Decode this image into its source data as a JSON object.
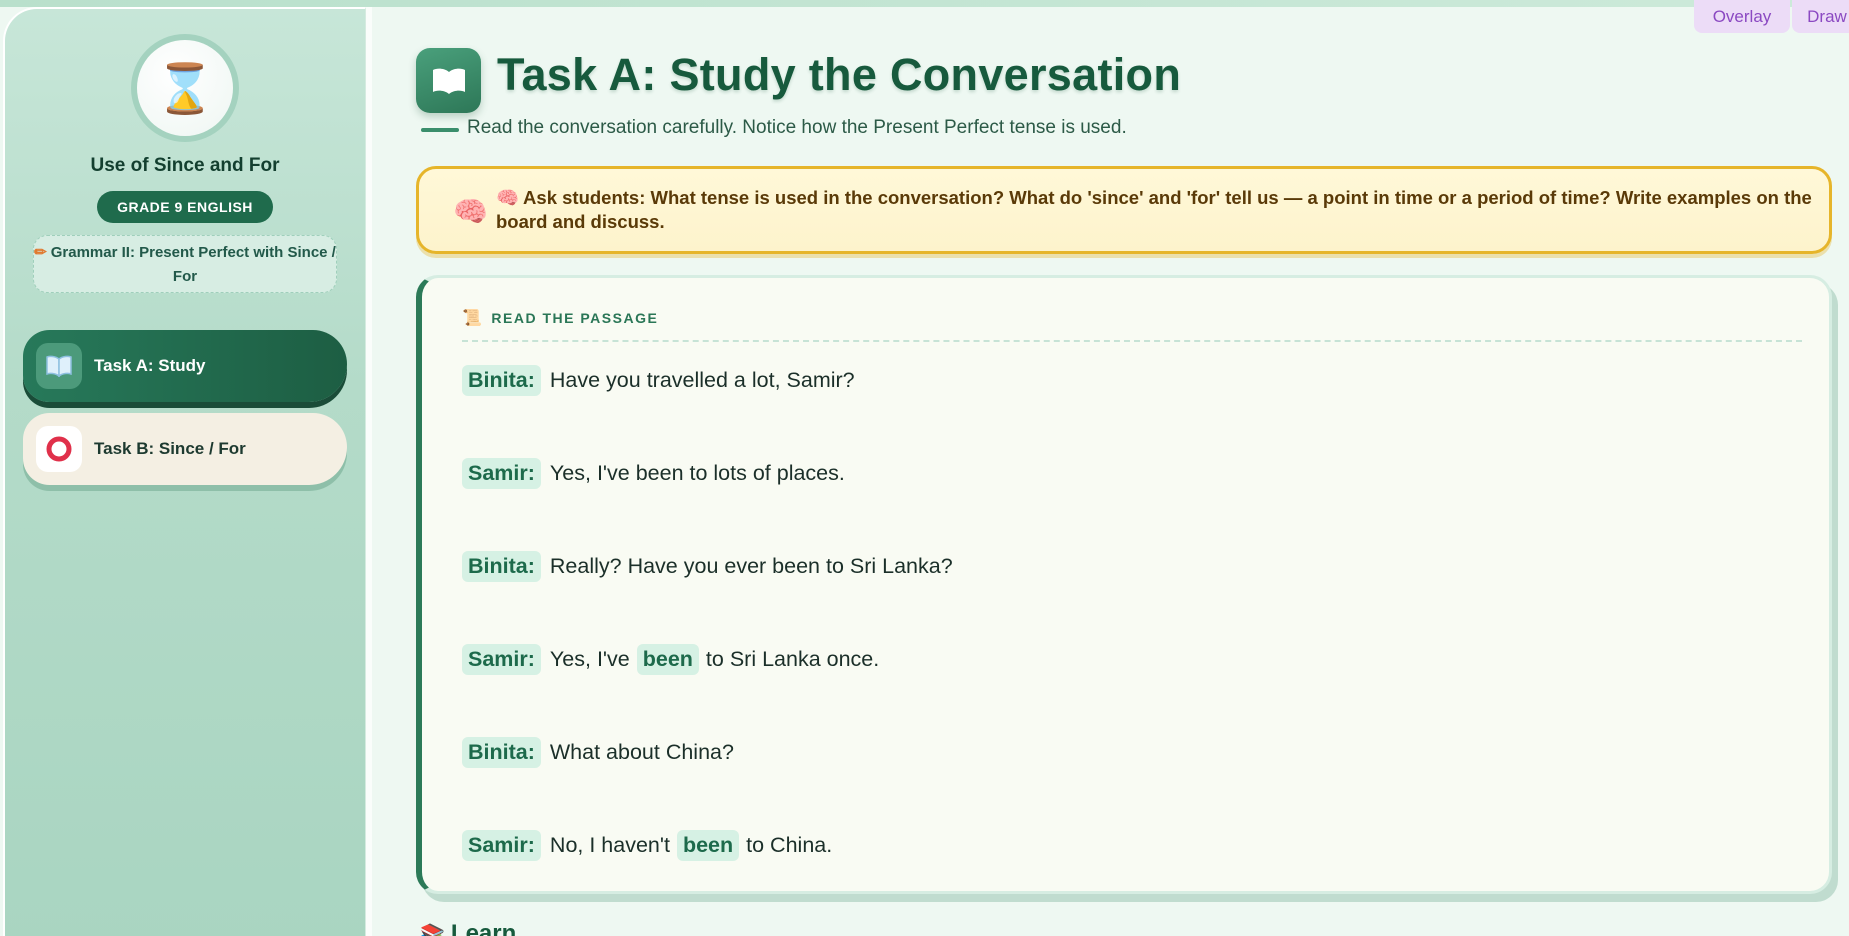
{
  "tools": {
    "overlay": "Overlay",
    "draw": "Draw"
  },
  "sidebar": {
    "title": "Use of Since and For",
    "grade": "GRADE 9 ENGLISH",
    "topic": "Grammar II: Present Perfect with Since / For",
    "avatar_icon": "hourglass-icon",
    "nav": [
      {
        "label": "Task A: Study",
        "icon": "book-icon",
        "active": true
      },
      {
        "label": "Task B: Since / For",
        "icon": "ring-icon",
        "active": false
      }
    ]
  },
  "main": {
    "title": "Task A: Study the Conversation",
    "subtitle": "Read the conversation carefully. Notice how the Present Perfect tense is used.",
    "tip": "Ask students: What tense is used in the conversation? What do 'since' and 'for' tell us — a point in time or a period of time? Write examples on the board and discuss.",
    "passage_label": "READ THE PASSAGE",
    "dialogue": [
      {
        "speaker": "Binita:",
        "before": "Have you travelled a lot, Samir?",
        "highlight": "",
        "after": ""
      },
      {
        "speaker": "Samir:",
        "before": "Yes, I've been to lots of places.",
        "highlight": "",
        "after": ""
      },
      {
        "speaker": "Binita:",
        "before": "Really? Have you ever been to Sri Lanka?",
        "highlight": "",
        "after": ""
      },
      {
        "speaker": "Samir:",
        "before": "Yes, I've",
        "highlight": "been",
        "after": "to Sri Lanka once."
      },
      {
        "speaker": "Binita:",
        "before": "What about China?",
        "highlight": "",
        "after": ""
      },
      {
        "speaker": "Samir:",
        "before": "No, I haven't",
        "highlight": "been",
        "after": "to China."
      }
    ],
    "next_section": "Learn"
  },
  "colors": {
    "accent": "#1f6b4c",
    "tip_border": "#e6b52a",
    "highlight_bg": "#d6f1e4",
    "tool_tab": "#ecdcf7"
  }
}
